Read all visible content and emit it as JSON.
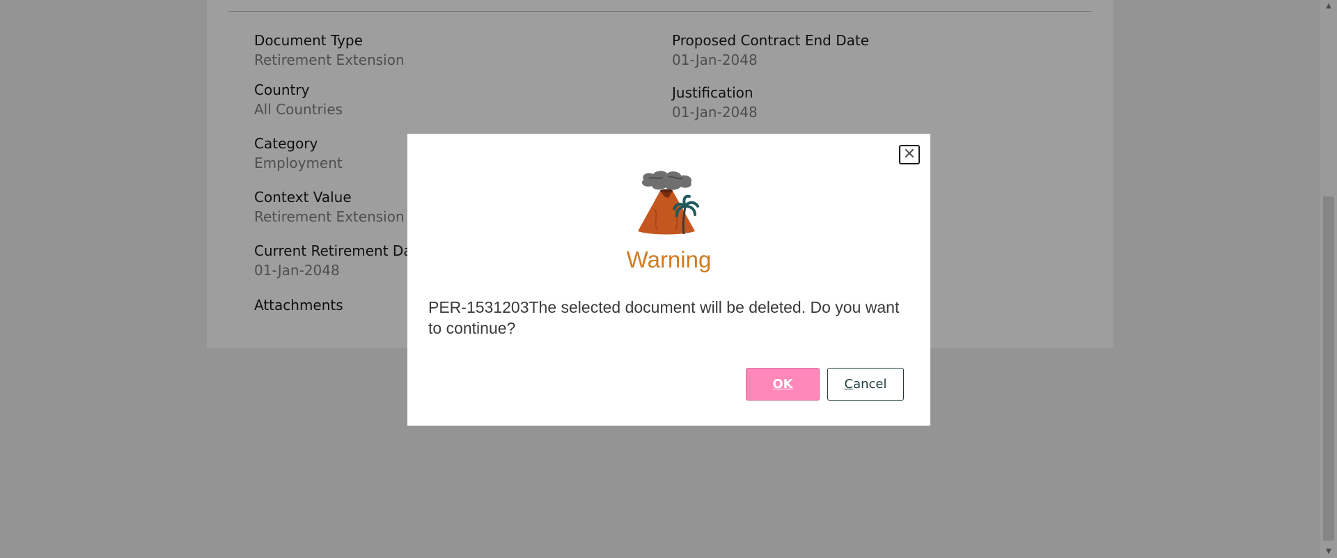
{
  "details": {
    "left": [
      {
        "label": "Document Type",
        "value": "Retirement Extension"
      },
      {
        "label": "Country",
        "value": "All Countries"
      },
      {
        "label": "Category",
        "value": "Employment"
      },
      {
        "label": "Context Value",
        "value": "Retirement Extension"
      },
      {
        "label": "Current Retirement Dat",
        "value": "01-Jan-2048"
      },
      {
        "label": "Attachments",
        "value": ""
      }
    ],
    "right": [
      {
        "label": "Proposed Contract End Date",
        "value": "01-Jan-2048"
      },
      {
        "label": "Justification",
        "value": "01-Jan-2048"
      }
    ]
  },
  "dialog": {
    "icon": "volcano-icon",
    "close_icon": "close-icon",
    "title": "Warning",
    "message": "PER-1531203The selected document will be deleted. Do you want to continue?",
    "ok_label": "OK",
    "cancel_label_first": "C",
    "cancel_label_rest": "ancel"
  },
  "colors": {
    "title": "#d07b22",
    "ok_button": "#ff88b8",
    "overlay": "#949494"
  }
}
